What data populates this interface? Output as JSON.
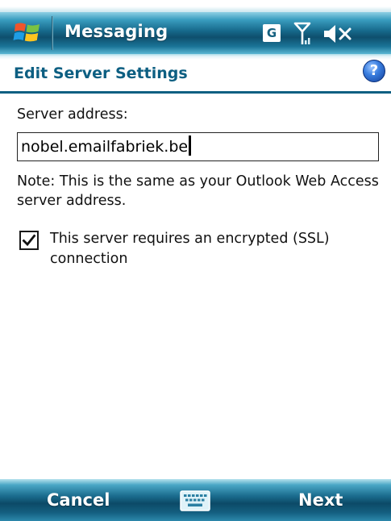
{
  "titlebar": {
    "app_title": "Messaging",
    "network_indicator": "G",
    "icons": [
      "windows-start-icon",
      "network-g-icon",
      "signal-icon",
      "speaker-muted-icon"
    ]
  },
  "header": {
    "title": "Edit Server Settings",
    "help_glyph": "?"
  },
  "form": {
    "server_label": "Server address:",
    "server_value": "nobel.emailfabriek.be",
    "note": "Note: This is the same as your Outlook Web Access server address.",
    "ssl_label": "This server requires an encrypted (SSL) connection",
    "ssl_checked": true
  },
  "softkeys": {
    "left": "Cancel",
    "right": "Next",
    "center_icon": "keyboard-icon"
  },
  "colors": {
    "accent": "#0d5f82",
    "titlebar": "#16688a",
    "text": "#111111"
  }
}
